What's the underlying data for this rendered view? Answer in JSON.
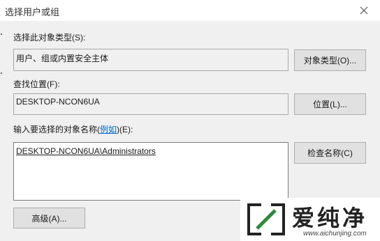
{
  "dialog": {
    "title": "选择用户或组",
    "object_type": {
      "label": "选择此对象类型(S):",
      "value": "用户、组或内置安全主体",
      "button": "对象类型(O)..."
    },
    "location": {
      "label": "查找位置(F):",
      "value": "DESKTOP-NCON6UA",
      "button": "位置(L)..."
    },
    "names": {
      "label_prefix": "输入要选择的对象名称(",
      "label_link": "例如",
      "label_suffix": ")(E):",
      "value": "DESKTOP-NCON6UA\\Administrators",
      "button": "检查名称(C)"
    },
    "advanced_button": "高级(A)..."
  },
  "watermark": {
    "text": "爱纯净",
    "url": "www.aichunjing.com"
  }
}
